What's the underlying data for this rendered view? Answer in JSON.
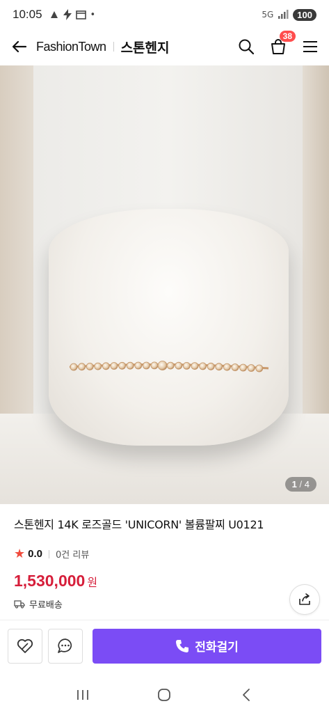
{
  "status_bar": {
    "time": "10:05",
    "network": "5G",
    "battery": "100"
  },
  "header": {
    "site_name": "FashionTown",
    "brand_name": "스톤헨지",
    "cart_count": "38"
  },
  "gallery": {
    "current": "1",
    "separator": "/",
    "total": "4"
  },
  "product": {
    "title": "스톤헨지 14K 로즈골드 'UNICORN' 볼륨팔찌 U0121",
    "rating": "0.0",
    "review_count": "0건 리뷰",
    "price": "1,530,000",
    "price_unit": "원",
    "shipping": "무료배송"
  },
  "actions": {
    "call_label": "전화걸기"
  },
  "colors": {
    "accent": "#7b4cf5",
    "price": "#d61e3a",
    "star": "#f04b3c",
    "badge": "#ff4d4d"
  },
  "icons": [
    "back-arrow-icon",
    "search-icon",
    "cart-icon",
    "menu-icon",
    "share-icon",
    "wishlist-icon",
    "chat-icon",
    "phone-icon",
    "truck-icon",
    "star-icon"
  ]
}
